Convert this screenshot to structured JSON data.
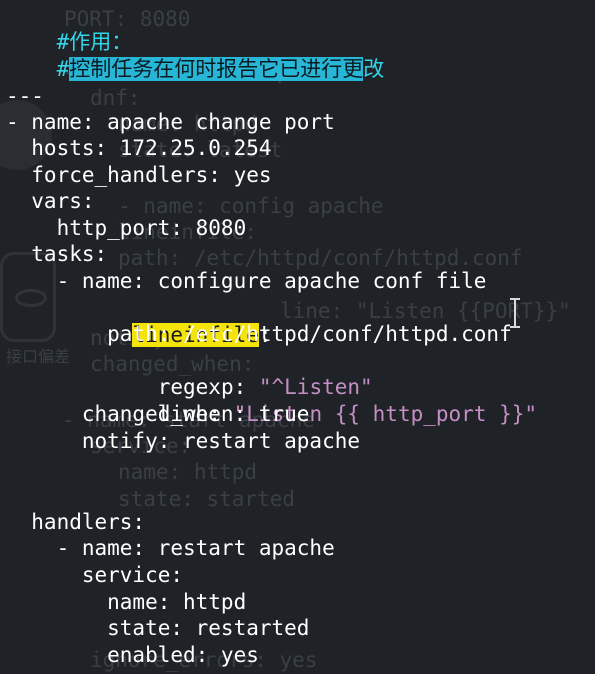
{
  "ghost_lines": [
    {
      "text": "PORT: 8080"
    },
    {
      "text": "- name: install apache"
    },
    {
      "text": "dnf:"
    },
    {
      "text": "name: httpd"
    },
    {
      "text": "state: latest"
    },
    {
      "text": "- name: config apache"
    },
    {
      "text": "lineinfile:"
    },
    {
      "text": "path: /etc/httpd/conf/httpd.conf"
    },
    {
      "text": "line: \"Listen {{PORT}}\""
    },
    {
      "text": "notify:"
    },
    {
      "text": "changed_when:"
    },
    {
      "text": "- name: start apache"
    },
    {
      "text": "service:"
    },
    {
      "text": "name: httpd"
    },
    {
      "text": "state: started"
    },
    {
      "text": "ignore_errors: yes"
    },
    {
      "text": "接口偏差"
    }
  ],
  "lines": [
    {
      "a": "#作用："
    },
    {
      "a": "#",
      "b": "控制任务在何时报告它已进行更",
      "c": "改"
    },
    {
      "a": ""
    },
    {
      "a": "---"
    },
    {
      "a": "- name: apache change port"
    },
    {
      "a": "  hosts: 172.25.0.254"
    },
    {
      "a": "  force_handlers: yes"
    },
    {
      "a": "  vars:"
    },
    {
      "a": "    http_port: 8080"
    },
    {
      "a": "  tasks:"
    },
    {
      "a": "    - name: configure apache conf file"
    },
    {
      "a": "      ",
      "b": "lineinfile",
      "c": ":"
    },
    {
      "a": "        path: /etc/httpd/conf/httpd.conf"
    },
    {
      "a": "        regexp: ",
      "b": "\"^Listen\""
    },
    {
      "a": "        line: ",
      "b": "\"Listen {{ http_port }}\""
    },
    {
      "a": "      changed_when: true"
    },
    {
      "a": "      notify: restart apache"
    },
    {
      "a": ""
    },
    {
      "a": ""
    },
    {
      "a": "  handlers:"
    },
    {
      "a": "    - name: restart apache"
    },
    {
      "a": "      service:"
    },
    {
      "a": "        name: httpd"
    },
    {
      "a": "        state: restarted"
    },
    {
      "a": "        enabled: yes"
    }
  ],
  "colors": {
    "background": "#1f2226",
    "comment": "#33d6e8",
    "comment_highlight": "#27b6d6",
    "string": "#c58fc5",
    "search_highlight": "#f4e40a",
    "text": "#ffffff"
  },
  "icons": {
    "cursor": "text-cursor-icon"
  }
}
